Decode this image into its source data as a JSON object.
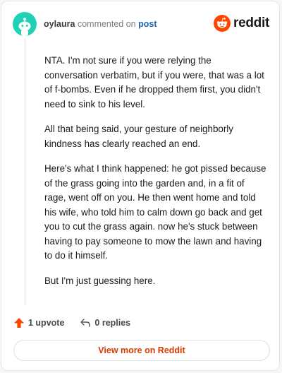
{
  "header": {
    "username": "oylaura",
    "action_text": "commented on",
    "post_link": "post",
    "brand": "reddit",
    "icons": {
      "avatar": "snoo-avatar-icon",
      "logo": "reddit-logo-icon"
    }
  },
  "comment": {
    "paragraphs": [
      "NTA. I'm not sure if you were relying the conversation verbatim, but if you were, that was a lot of f-bombs. Even if he dropped them first, you didn't need to sink to his level.",
      "All that being said, your gesture of neighborly kindness has clearly reached an end.",
      "Here's what I think happened: he got pissed because of the grass going into the garden and, in a fit of rage, went off on you. He then went home and told his wife, who told him to calm down go back and get you to cut the grass again. now he's stuck between having to pay someone to mow the lawn and having to do it himself.",
      "But I'm just guessing here."
    ]
  },
  "actions": {
    "upvotes": "1 upvote",
    "replies": "0 replies",
    "icons": {
      "upvote": "upvote-arrow-icon",
      "reply": "reply-arrow-icon"
    }
  },
  "footer": {
    "view_more": "View more on Reddit"
  },
  "colors": {
    "accent": "#d93a00",
    "upvote": "#ff4500",
    "avatar_bg": "#1fd1b5",
    "link": "#1a63b8"
  }
}
